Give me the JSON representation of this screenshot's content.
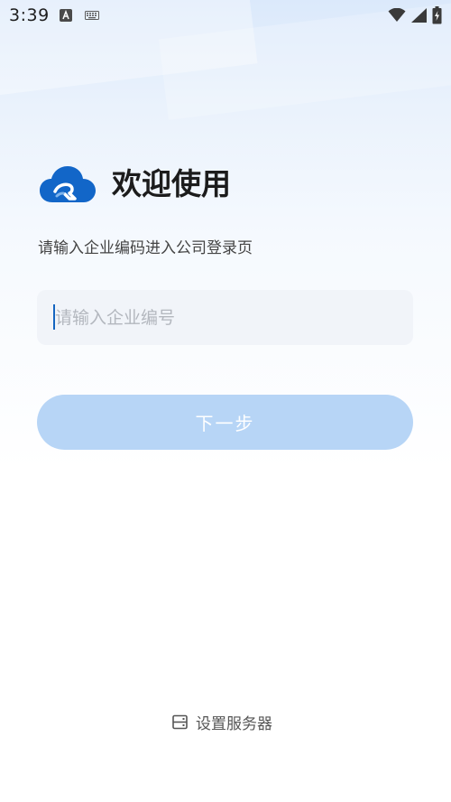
{
  "status_bar": {
    "time": "3:39",
    "icons": [
      "font-a-icon",
      "keyboard-icon",
      "wifi-icon",
      "signal-icon",
      "battery-icon"
    ]
  },
  "header": {
    "logo_icon": "cloud-logo-icon",
    "welcome_title": "欢迎使用",
    "subtitle": "请输入企业编码进入公司登录页"
  },
  "form": {
    "enterprise_code": {
      "value": "",
      "placeholder": "请输入企业编号"
    },
    "next_label": "下一步"
  },
  "footer": {
    "server_icon": "server-icon",
    "server_label": "设置服务器"
  },
  "colors": {
    "primary_blue": "#1565c0",
    "button_disabled": "#b7d5f6",
    "input_bg": "#f1f4f9",
    "placeholder": "#b3b7be"
  }
}
